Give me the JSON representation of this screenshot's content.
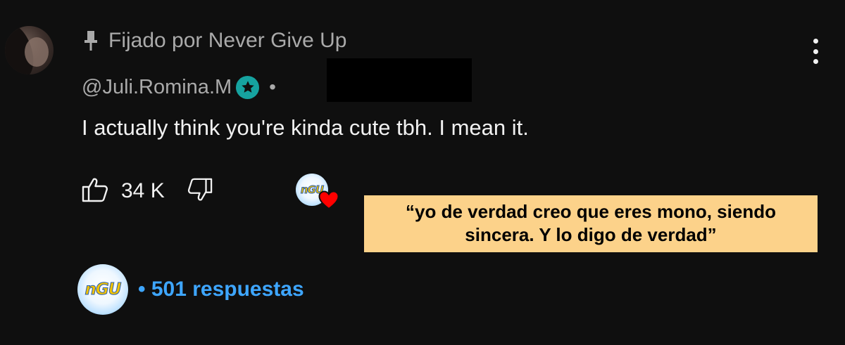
{
  "comment": {
    "pinned_label": "Fijado por Never Give Up",
    "author_handle": "@Juli.Romina.M",
    "separator": "•",
    "text": "I actually think you're kinda cute tbh. I mean it.",
    "like_count": "34 K",
    "icons": {
      "pin": "pin-icon",
      "badge": "star-badge-icon",
      "like": "thumbs-up-icon",
      "dislike": "thumbs-down-icon",
      "heart": "heart-icon",
      "menu": "more-vert-icon"
    },
    "colors": {
      "background": "#0f0f0f",
      "badge": "#16a3a0",
      "reply_link": "#3ea6ff",
      "heart": "#ff0000"
    }
  },
  "creator": {
    "logo_text": "nGU"
  },
  "translation": {
    "line1": "“yo de verdad creo que eres mono, siendo",
    "line2": "sincera. Y lo digo de verdad”",
    "background": "#fcd28a"
  },
  "replies": {
    "label": "• 501 respuestas"
  }
}
